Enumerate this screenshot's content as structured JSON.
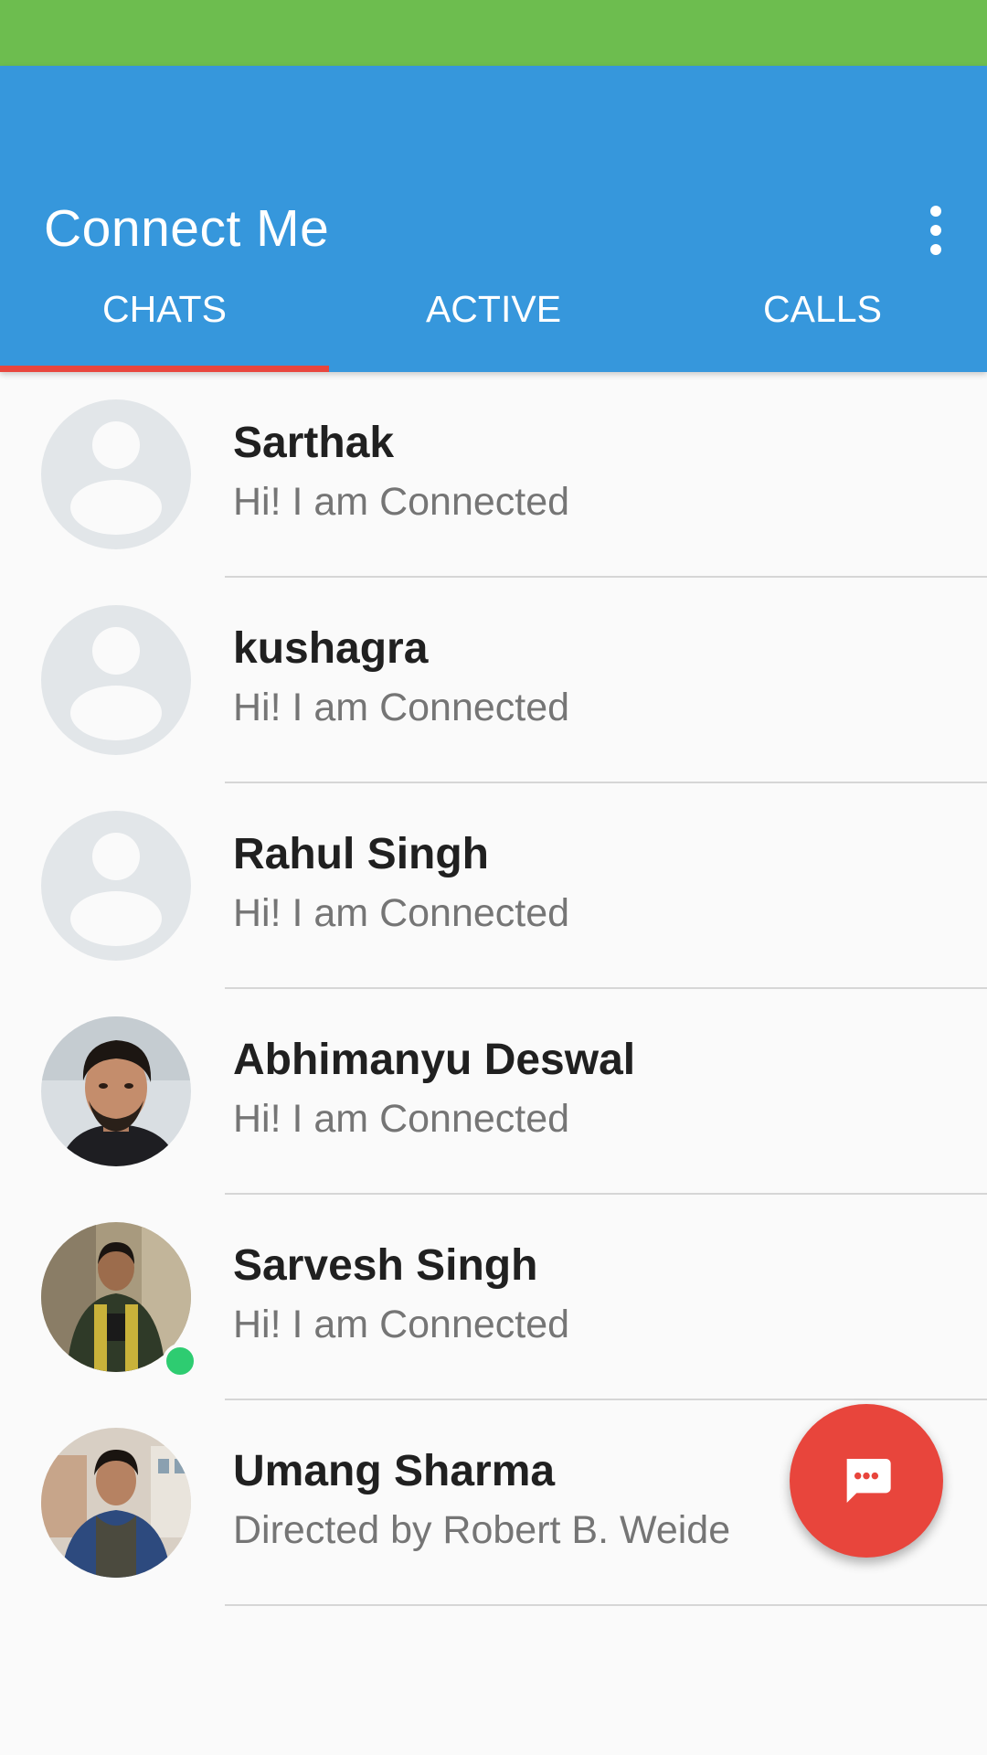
{
  "app": {
    "title": "Connect Me",
    "menu_icon": "more-vertical-icon",
    "colors": {
      "status_bar": "#6dbd4f",
      "app_bar": "#3697dc",
      "accent": "#e8453c",
      "online": "#2ecc71"
    }
  },
  "tabs": [
    {
      "label": "CHATS",
      "active": true
    },
    {
      "label": "ACTIVE",
      "active": false
    },
    {
      "label": "CALLS",
      "active": false
    }
  ],
  "chats": [
    {
      "name": "Sarthak",
      "status": "Hi! I am Connected",
      "avatar": "default-avatar-icon",
      "online": false
    },
    {
      "name": "kushagra",
      "status": "Hi! I am Connected",
      "avatar": "default-avatar-icon",
      "online": false
    },
    {
      "name": "Rahul Singh",
      "status": "Hi! I am Connected",
      "avatar": "default-avatar-icon",
      "online": false
    },
    {
      "name": "Abhimanyu Deswal",
      "status": "Hi! I am Connected",
      "avatar": "profile-photo",
      "online": false
    },
    {
      "name": "Sarvesh Singh",
      "status": "Hi! I am Connected",
      "avatar": "profile-photo",
      "online": true
    },
    {
      "name": "Umang Sharma",
      "status": "Directed by Robert B. Weide",
      "avatar": "profile-photo",
      "online": false
    }
  ],
  "fab": {
    "icon": "chat-bubble-icon"
  }
}
